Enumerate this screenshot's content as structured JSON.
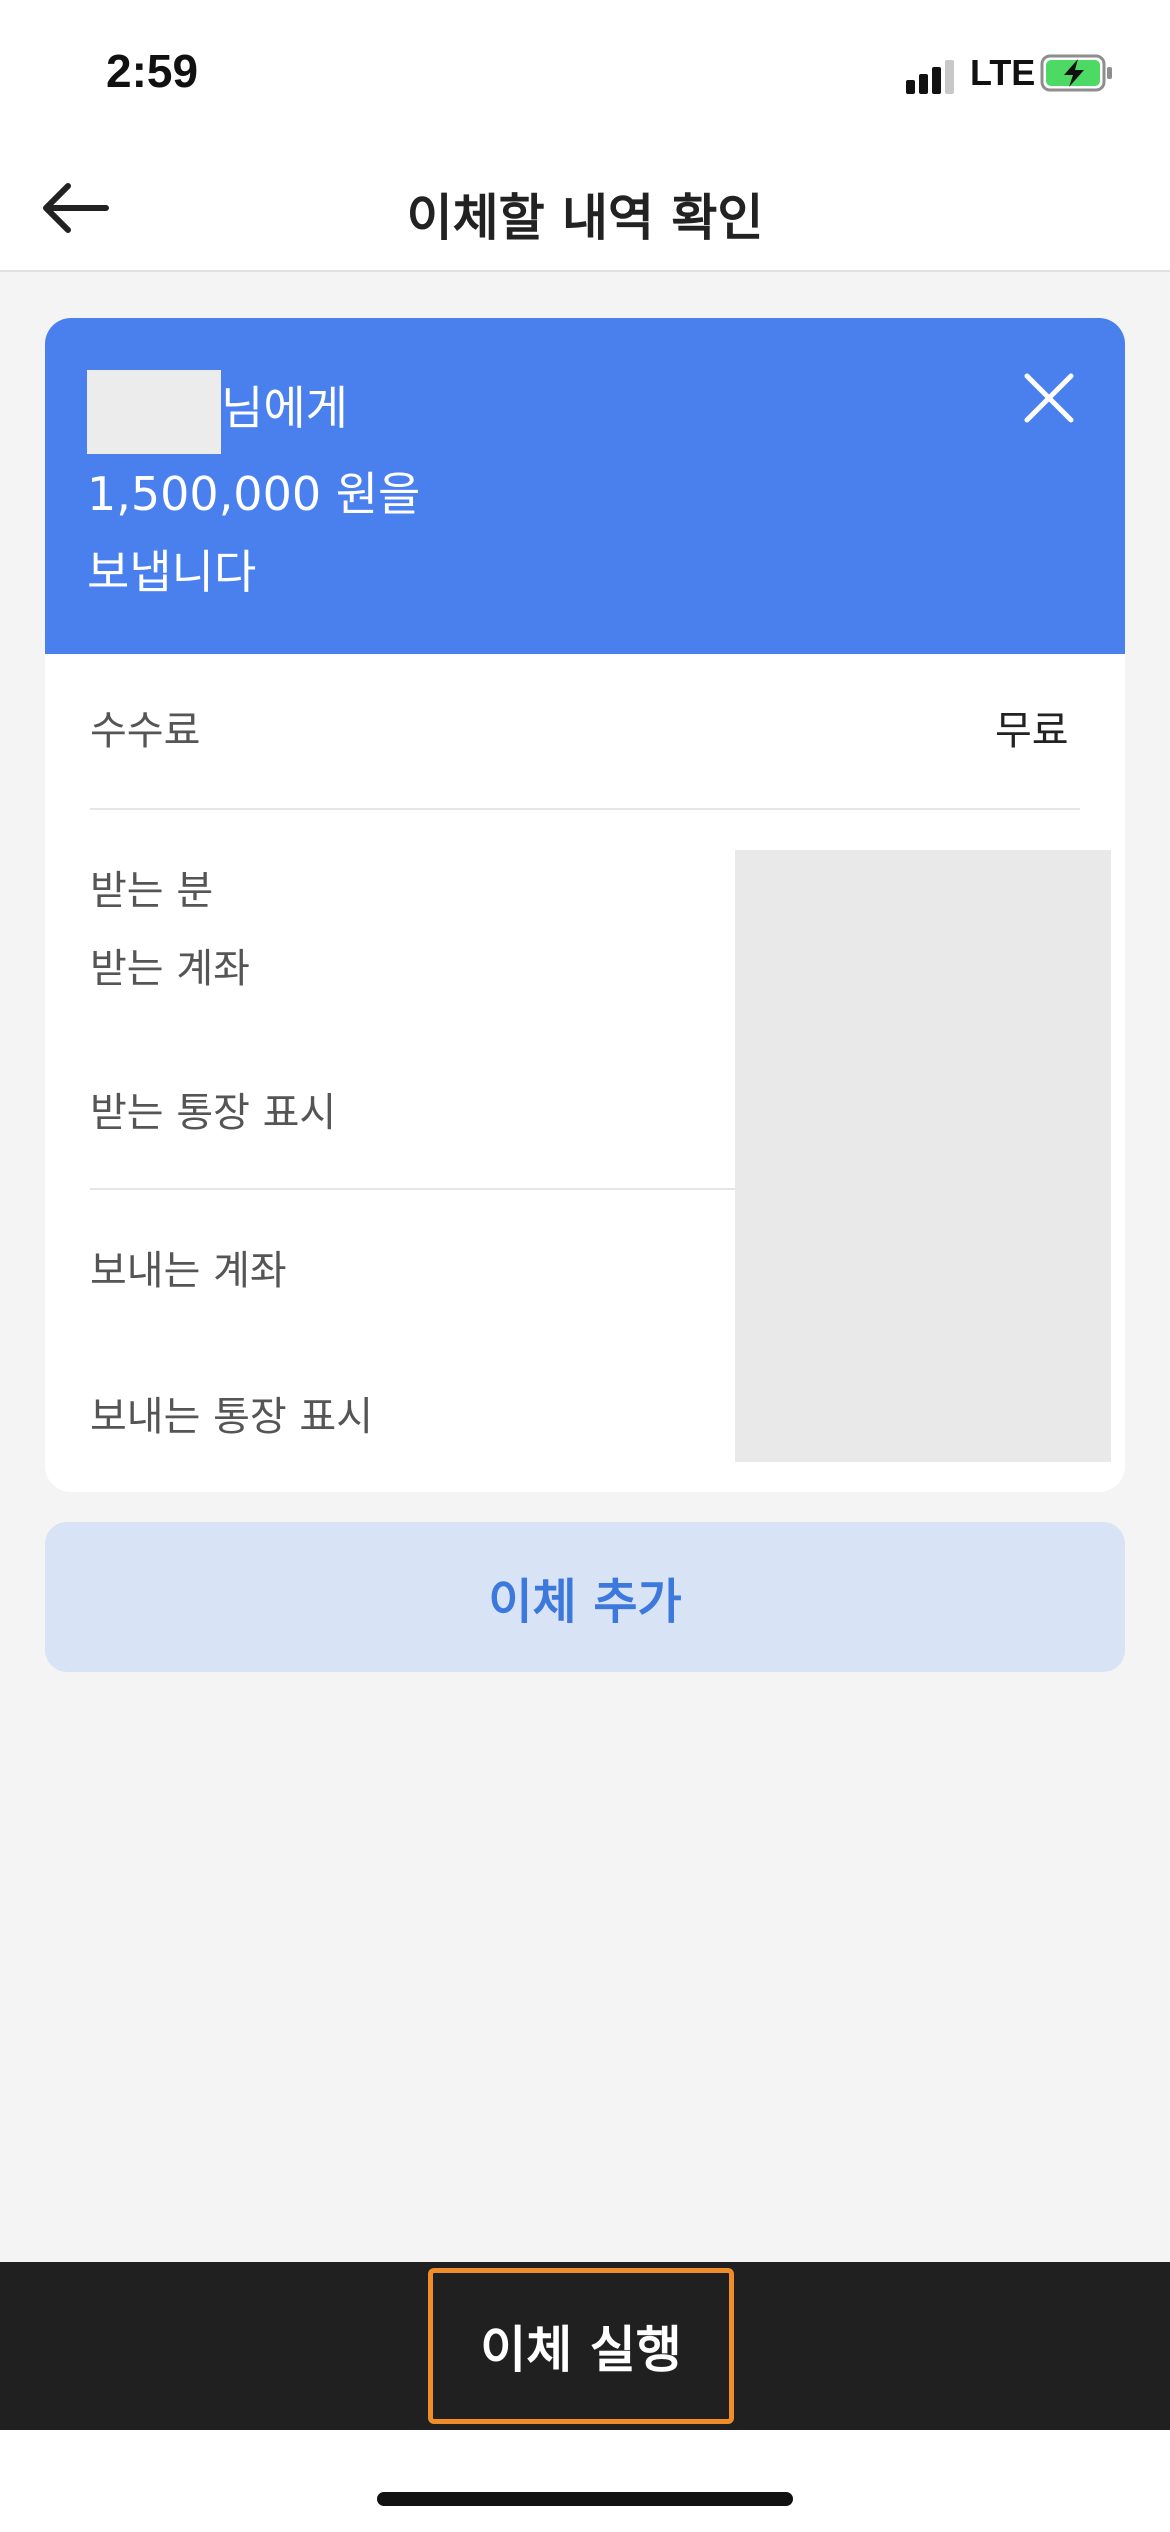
{
  "status_bar": {
    "time": "2:59",
    "network": "LTE",
    "signal_bars_active": 3,
    "signal_bars_total": 4,
    "battery_state": "charging",
    "battery_color": "#4cd964"
  },
  "header": {
    "title": "이체할 내역 확인",
    "back_icon": "arrow-left-icon"
  },
  "summary": {
    "recipient_suffix": "님에게",
    "amount_line": "1,500,000 원을",
    "action_line": "보냅니다",
    "close_icon": "close-icon",
    "accent_color": "#4a80ee"
  },
  "details": {
    "fee_label": "수수료",
    "fee_value": "무료",
    "recipient_name_label": "받는 분",
    "recipient_account_label": "받는 계좌",
    "recipient_memo_label": "받는 통장 표시",
    "sender_account_label": "보내는 계좌",
    "sender_memo_label": "보내는 통장 표시"
  },
  "actions": {
    "add_transfer_label": "이체 추가",
    "execute_label": "이체 실행",
    "highlight_color": "#ef8d2a"
  }
}
